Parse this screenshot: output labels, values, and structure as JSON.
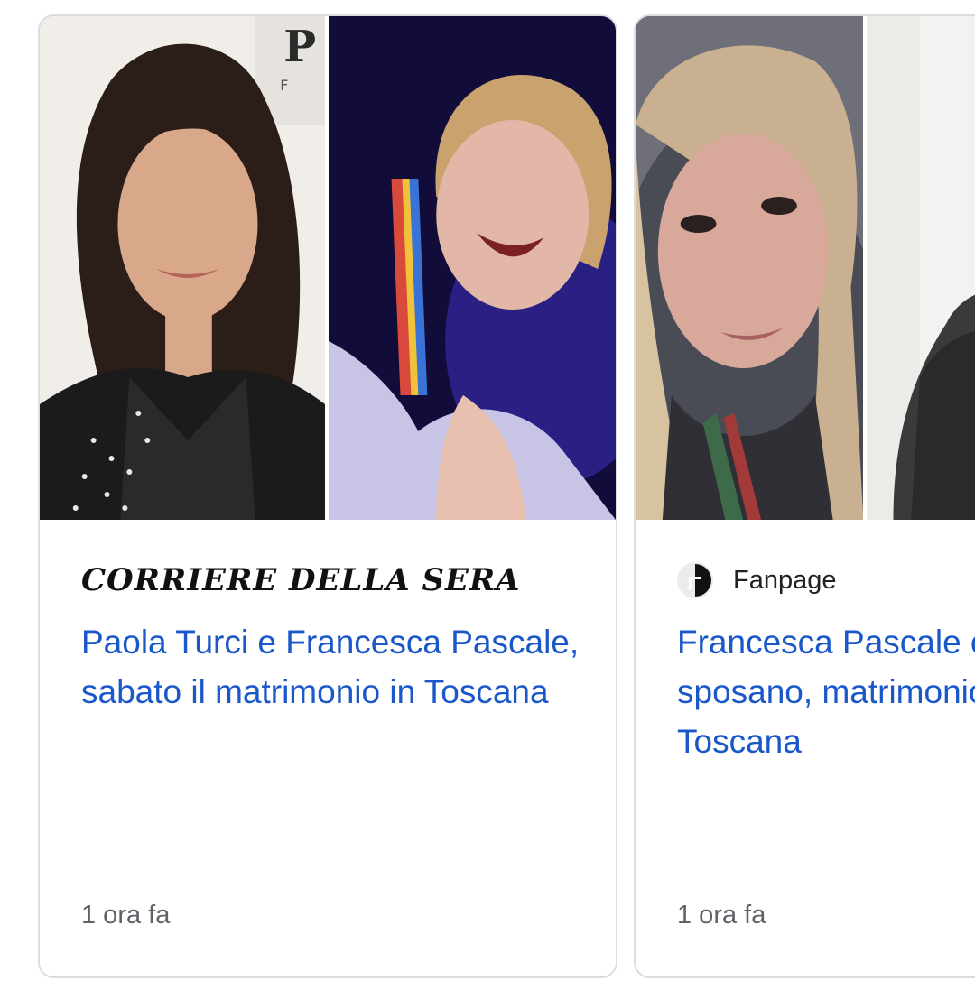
{
  "cards": [
    {
      "source": "CORRIERE DELLA SERA",
      "headline": "Paola Turci e Francesca Pascale, sabato il matrimonio in Toscana",
      "time": "1 ora fa"
    },
    {
      "source": "Fanpage",
      "headline": "Francesca Pascale e Paola Turci si sposano, matrimonio segreto in Toscana",
      "time": "1 ora fa"
    }
  ],
  "colors": {
    "headline": "#1a57c9",
    "meta": "#5f6368",
    "border": "#dadce0"
  }
}
